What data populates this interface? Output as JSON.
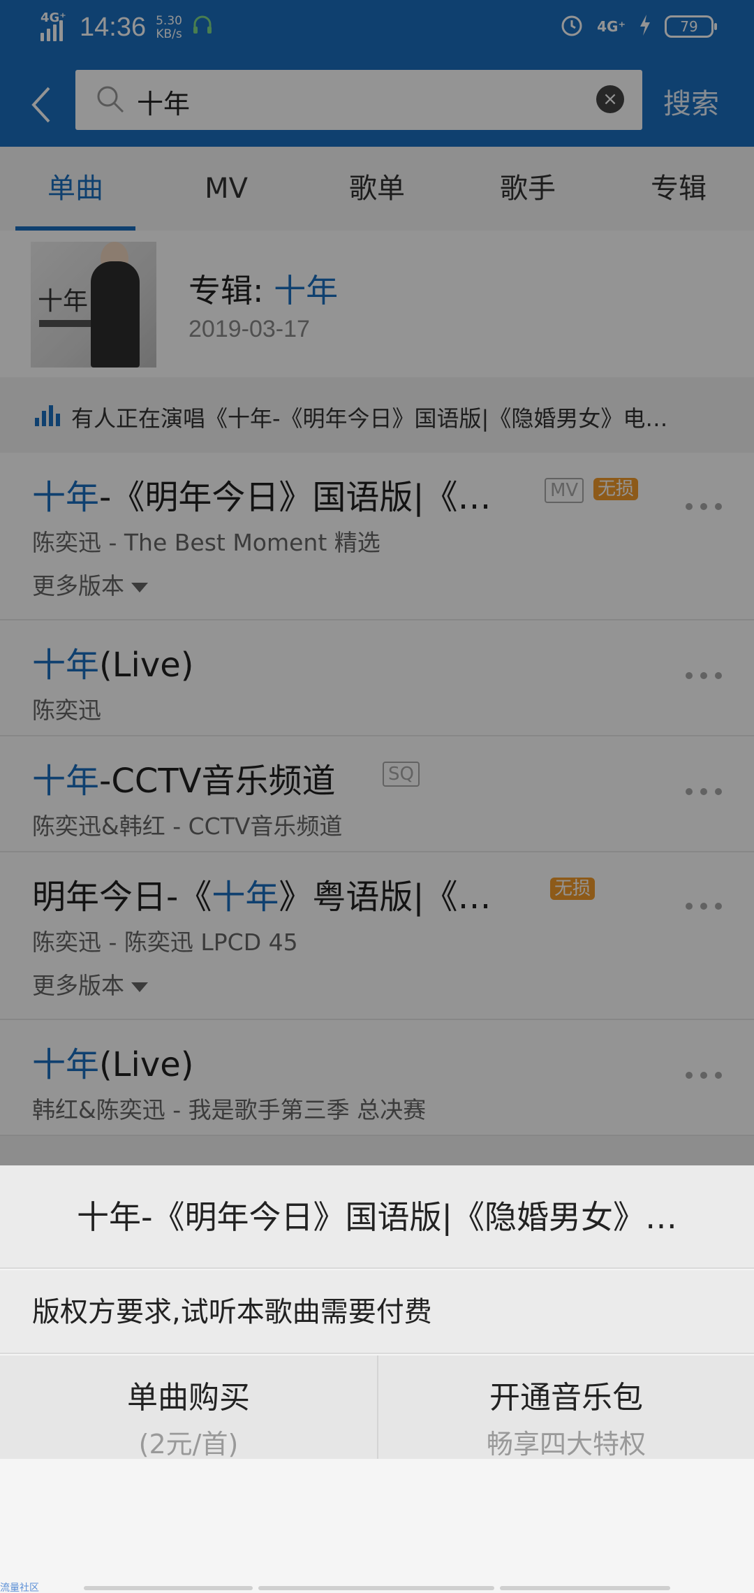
{
  "status_bar": {
    "network": "4G⁺",
    "time": "14:36",
    "speed_value": "5.30",
    "speed_unit": "KB/s",
    "right_network": "4G⁺",
    "battery": "79"
  },
  "header": {
    "search_value": "十年",
    "search_button": "搜索"
  },
  "tabs": [
    {
      "label": "单曲",
      "active": true
    },
    {
      "label": "MV",
      "active": false
    },
    {
      "label": "歌单",
      "active": false
    },
    {
      "label": "歌手",
      "active": false
    },
    {
      "label": "专辑",
      "active": false
    }
  ],
  "album": {
    "prefix": "专辑: ",
    "name": "十年",
    "date": "2019-03-17",
    "cover_text": "十年"
  },
  "singing_banner": "有人正在演唱《十年-《明年今日》国语版|《隐婚男女》电…",
  "songs": [
    {
      "title_pre": "",
      "title_hl": "十年",
      "title_post": "-《明年今日》国语版|《…",
      "subtitle": "陈奕迅 - The Best Moment 精选",
      "more_versions": "更多版本",
      "badges": [
        "MV",
        "无损"
      ]
    },
    {
      "title_pre": "",
      "title_hl": "十年",
      "title_post": "(Live)",
      "subtitle": "陈奕迅",
      "badges": []
    },
    {
      "title_pre": "",
      "title_hl": "十年",
      "title_post": "-CCTV音乐频道",
      "subtitle": "陈奕迅&韩红 - CCTV音乐频道",
      "badges": [
        "SQ"
      ]
    },
    {
      "title_pre": "明年今日-《",
      "title_hl": "十年",
      "title_post": "》粤语版|《…",
      "subtitle": "陈奕迅 - 陈奕迅 LPCD 45",
      "more_versions": "更多版本",
      "badges": [
        "无损"
      ]
    },
    {
      "title_pre": "",
      "title_hl": "十年",
      "title_post": "(Live)",
      "subtitle": "韩红&陈奕迅 - 我是歌手第三季 总决赛",
      "badges": []
    }
  ],
  "sheet": {
    "title": "十年-《明年今日》国语版|《隐婚男女》…",
    "message": "版权方要求,试听本歌曲需要付费",
    "buy_single": "单曲购买",
    "buy_single_price": "(2元/首)",
    "music_pack": "开通音乐包",
    "music_pack_sub": "畅享四大特权"
  },
  "watermark": "流量社区",
  "colors": {
    "accent": "#1b6fbf",
    "lossless_badge": "#f39c2b"
  }
}
